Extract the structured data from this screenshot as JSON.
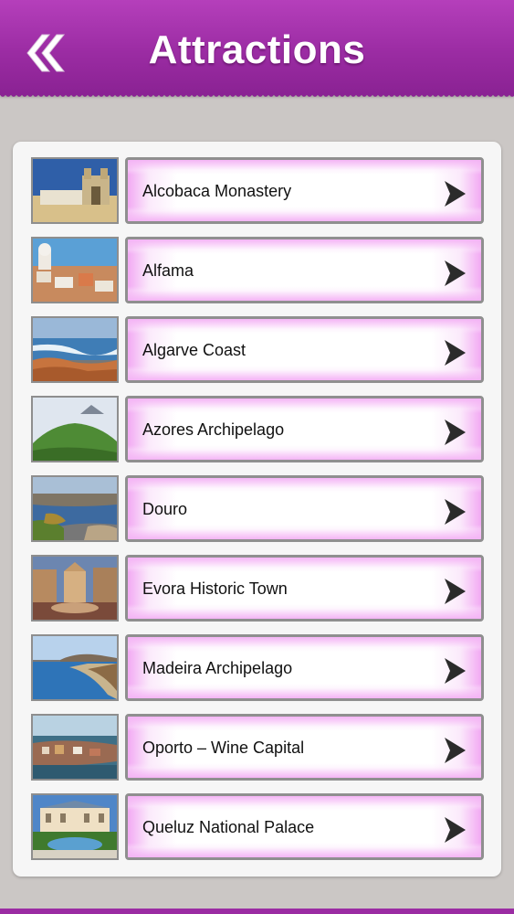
{
  "header": {
    "title": "Attractions",
    "back_icon": "double-chevron-left-icon",
    "background": "#9b2ca3"
  },
  "list": {
    "items": [
      {
        "label": "Alcobaca Monastery",
        "thumb": "monastery"
      },
      {
        "label": "Alfama",
        "thumb": "alfama"
      },
      {
        "label": "Algarve Coast",
        "thumb": "coast"
      },
      {
        "label": "Azores Archipelago",
        "thumb": "azores"
      },
      {
        "label": "Douro",
        "thumb": "douro"
      },
      {
        "label": "Evora Historic Town",
        "thumb": "evora"
      },
      {
        "label": "Madeira Archipelago",
        "thumb": "madeira"
      },
      {
        "label": "Oporto – Wine Capital",
        "thumb": "oporto"
      },
      {
        "label": "Queluz National Palace",
        "thumb": "queluz"
      }
    ],
    "chevron_icon": "chevron-right-icon",
    "accent": "#f2a9f3"
  }
}
